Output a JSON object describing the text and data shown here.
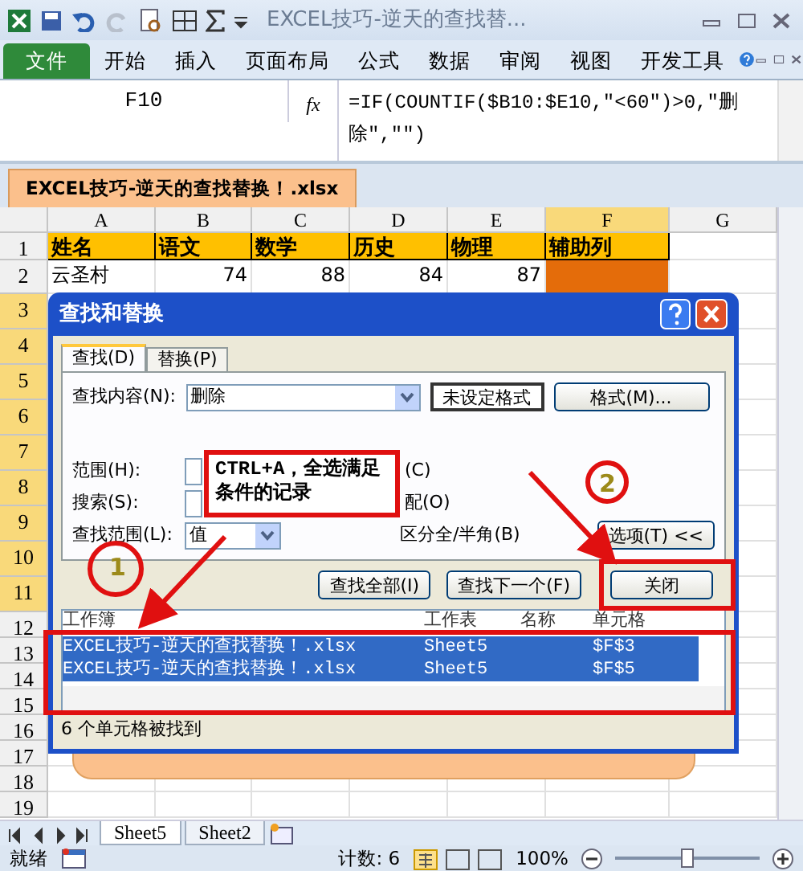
{
  "title_bar": {
    "title": "EXCEL技巧-逆天的查找替..."
  },
  "ribbon_tabs": [
    {
      "label": "文件",
      "kind": "file"
    },
    {
      "label": "开始",
      "kind": "tab"
    },
    {
      "label": "插入",
      "kind": "tab"
    },
    {
      "label": "页面布局",
      "kind": "tab"
    },
    {
      "label": "公式",
      "kind": "tab"
    },
    {
      "label": "数据",
      "kind": "tab"
    },
    {
      "label": "审阅",
      "kind": "tab"
    },
    {
      "label": "视图",
      "kind": "tab"
    },
    {
      "label": "开发工具",
      "kind": "tab"
    }
  ],
  "formula_bar": {
    "name_box": "F10",
    "fx_label": "fx",
    "formula": "=IF(COUNTIF($B10:$E10,\"<60\")>0,\"删除\",\"\")"
  },
  "workbook_tab": {
    "label": "EXCEL技巧-逆天的查找替换！.xlsx"
  },
  "sheet": {
    "columns": [
      {
        "label": "A",
        "selected": false
      },
      {
        "label": "B",
        "selected": false
      },
      {
        "label": "C",
        "selected": false
      },
      {
        "label": "D",
        "selected": false
      },
      {
        "label": "E",
        "selected": false
      },
      {
        "label": "F",
        "selected": true
      },
      {
        "label": "G",
        "selected": false
      }
    ],
    "rows": [
      {
        "header": "1",
        "selected": false,
        "cells": [
          {
            "text": "姓名",
            "kind": "title",
            "color": "#ffc000"
          },
          {
            "text": "语文",
            "kind": "title",
            "color": "#ffc000"
          },
          {
            "text": "数学",
            "kind": "title",
            "color": "#ffc000"
          },
          {
            "text": "历史",
            "kind": "title",
            "color": "#ffc000"
          },
          {
            "text": "物理",
            "kind": "title",
            "color": "#ffc000"
          },
          {
            "text": "辅助列",
            "kind": "title",
            "color": "#ffc000"
          }
        ]
      },
      {
        "header": "2",
        "selected": false,
        "cells": [
          {
            "text": "云圣村",
            "kind": "text"
          },
          {
            "text": "74",
            "kind": "number"
          },
          {
            "text": "88",
            "kind": "number"
          },
          {
            "text": "84",
            "kind": "number"
          },
          {
            "text": "87",
            "kind": "number"
          },
          {
            "text": "",
            "kind": "fill",
            "color": "#e46c0a"
          }
        ]
      },
      {
        "header": "3",
        "selected": true
      },
      {
        "header": "4",
        "selected": true
      },
      {
        "header": "5",
        "selected": true
      },
      {
        "header": "6",
        "selected": true
      },
      {
        "header": "7",
        "selected": true
      },
      {
        "header": "8",
        "selected": true
      },
      {
        "header": "9",
        "selected": true
      },
      {
        "header": "10",
        "selected": true
      },
      {
        "header": "11",
        "selected": true
      },
      {
        "header": "12",
        "selected": false
      },
      {
        "header": "13",
        "selected": false
      },
      {
        "header": "14",
        "selected": false
      },
      {
        "header": "15",
        "selected": false
      },
      {
        "header": "16",
        "selected": false
      },
      {
        "header": "17",
        "selected": false
      },
      {
        "header": "18",
        "selected": false
      },
      {
        "header": "19",
        "selected": false
      }
    ]
  },
  "dialog": {
    "title": "查找和替换",
    "tabs": [
      {
        "label": "查找(D)",
        "selected": true
      },
      {
        "label": "替换(P)",
        "selected": false
      }
    ],
    "find_label": "查找内容(N):",
    "find_value": "删除",
    "format_status": "未设定格式",
    "format_button": "格式(M)...",
    "option_rows": [
      {
        "label": "范围(H):",
        "check": "(C)"
      },
      {
        "label": "搜索(S):",
        "check": "配(O)"
      },
      {
        "label": "查找范围(L):",
        "value": "值",
        "check": "区分全/半角(B)"
      }
    ],
    "options_button": "选项(T) <<",
    "buttons": [
      "查找全部(I)",
      "查找下一个(F)",
      "关闭"
    ],
    "results": {
      "columns": [
        "工作簿",
        "工作表",
        "名称",
        "单元格"
      ],
      "rows": [
        {
          "selected": true,
          "cells": [
            "EXCEL技巧-逆天的查找替换！.xlsx",
            "Sheet5",
            "",
            "$F$3"
          ]
        },
        {
          "selected": true,
          "cells": [
            "EXCEL技巧-逆天的查找替换！.xlsx",
            "Sheet5",
            "",
            "$F$5"
          ]
        }
      ]
    },
    "status": "6 个单元格被找到"
  },
  "annotations": {
    "callout": "CTRL+A，全选满足条件的记录",
    "markers": [
      "1",
      "2"
    ]
  },
  "sheet_tabs": [
    {
      "label": "Sheet5",
      "selected": true
    },
    {
      "label": "Sheet2",
      "selected": false
    }
  ],
  "status_bar": {
    "mode": "就绪",
    "count": "计数: 6",
    "zoom": "100%",
    "level": 0.5
  }
}
